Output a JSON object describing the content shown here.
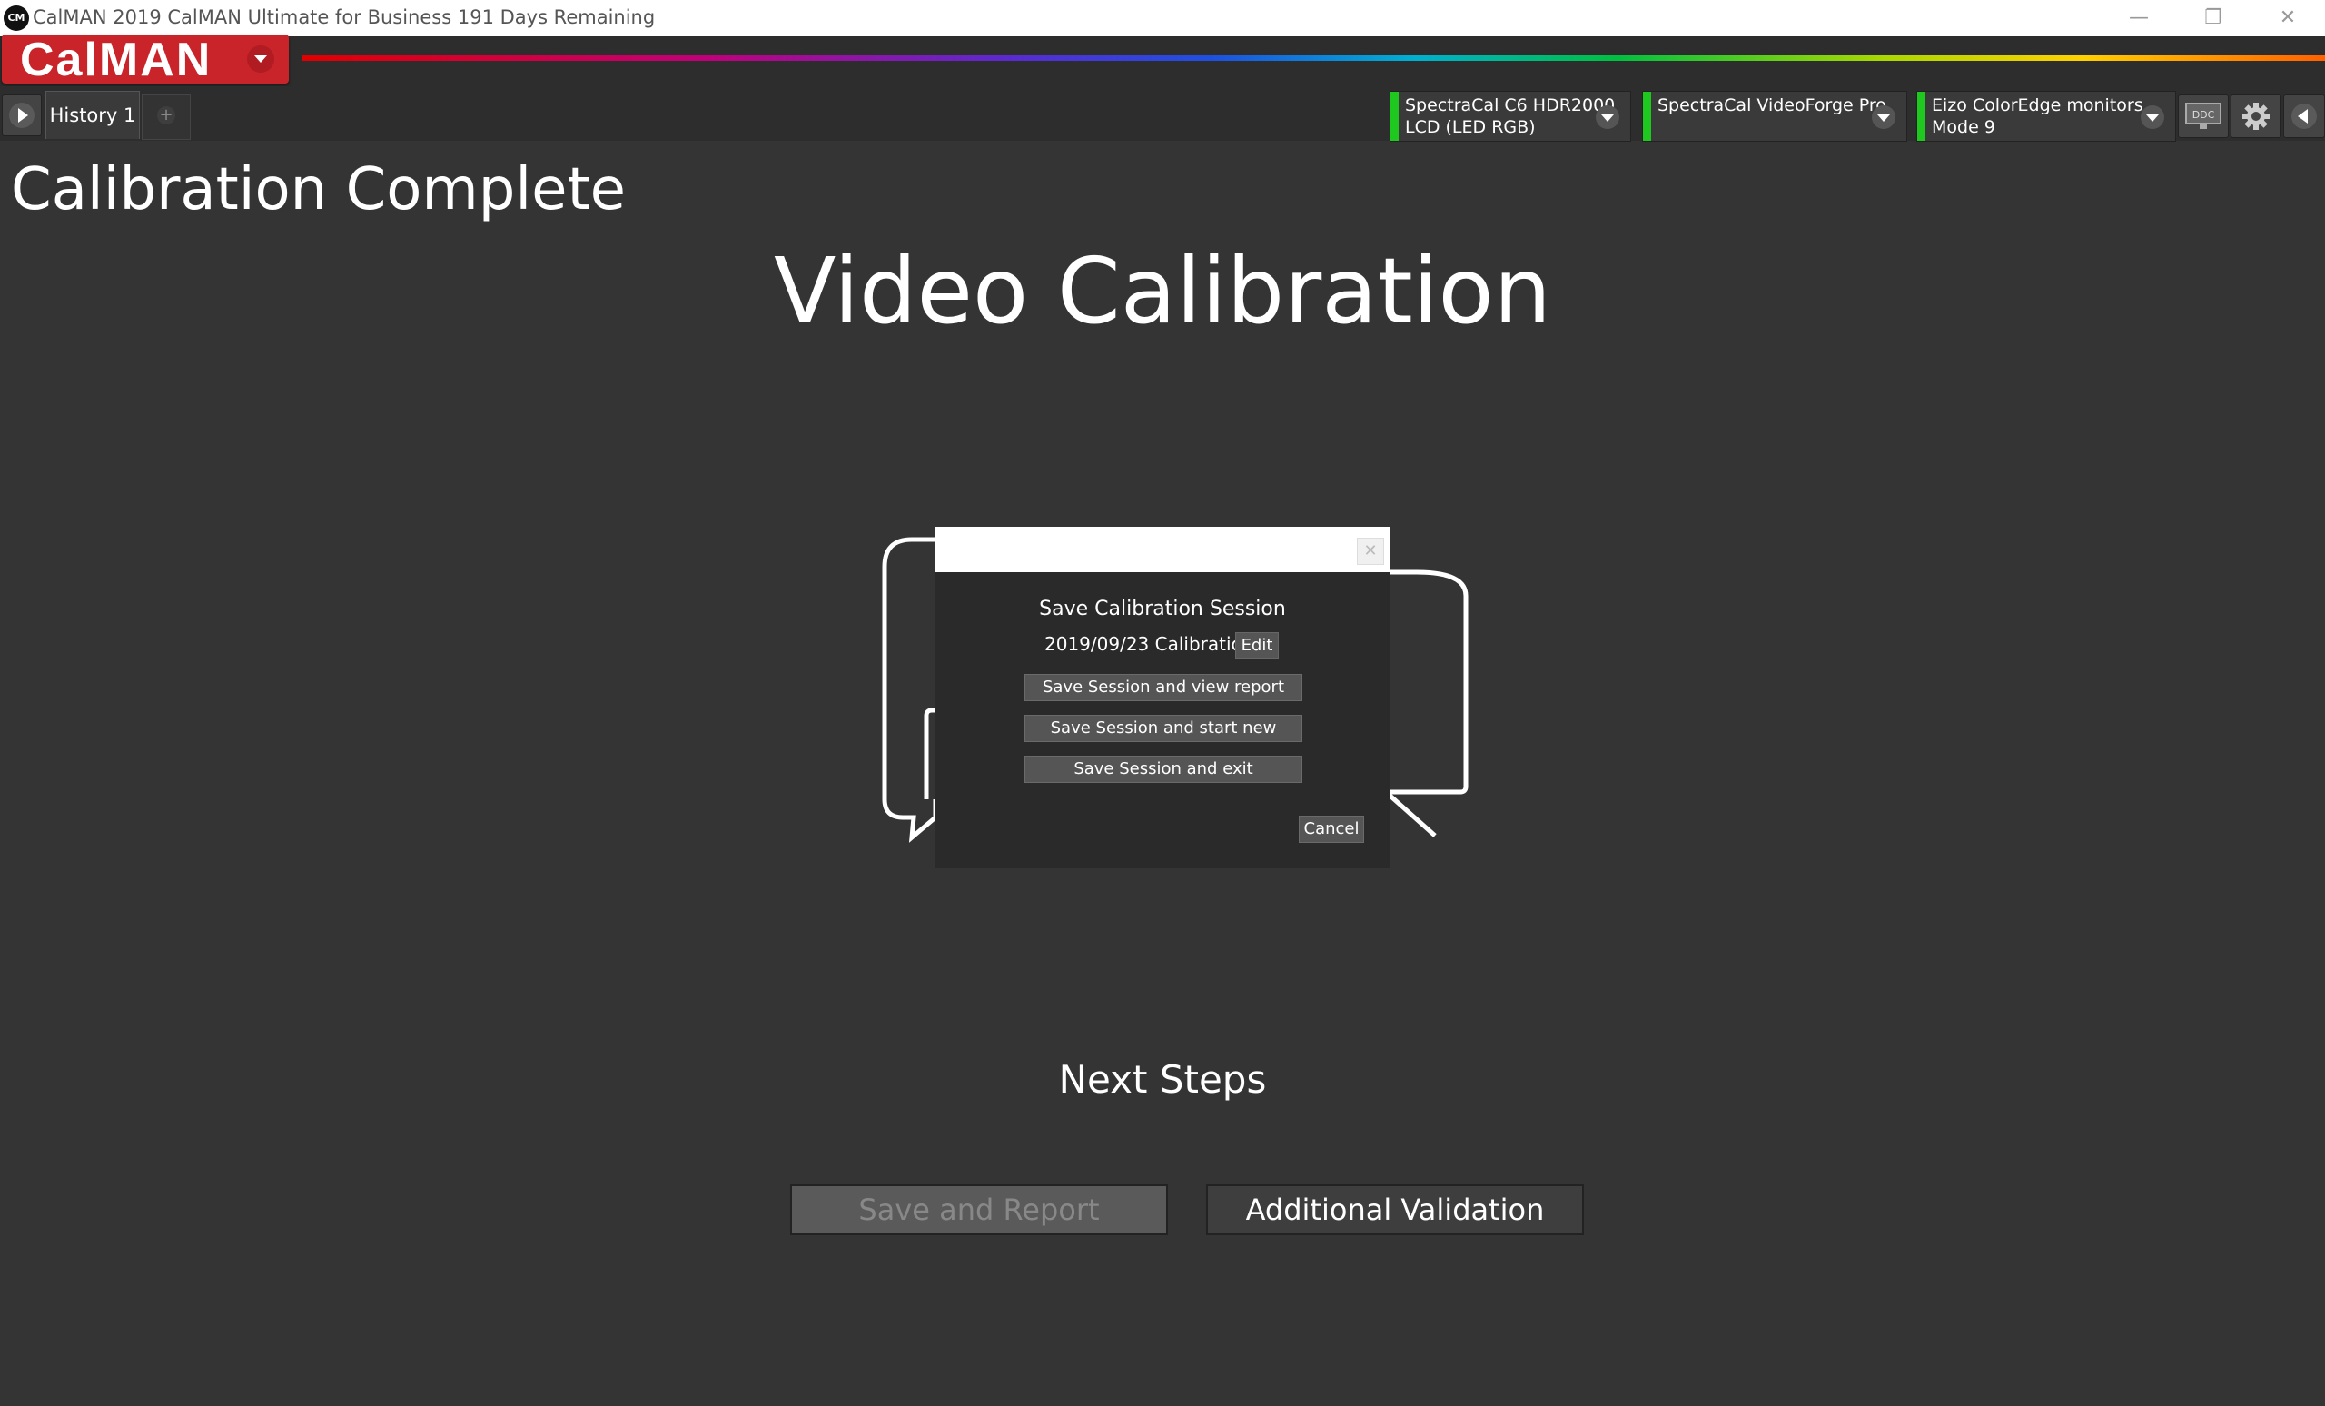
{
  "window": {
    "app_icon": "CM",
    "title": "CalMAN 2019 CalMAN Ultimate for Business 191 Days Remaining",
    "controls": {
      "minimize": "—",
      "restore": "❐",
      "close": "✕"
    }
  },
  "brand": {
    "logo_text": "CalMAN"
  },
  "tabs": [
    {
      "label": "History 1"
    }
  ],
  "tab_add_label": "+",
  "devices": [
    {
      "line1": "SpectraCal C6 HDR2000",
      "line2": "LCD (LED RGB)",
      "status_color": "#1ec81e"
    },
    {
      "line1": "SpectraCal VideoForge Pro",
      "line2": "",
      "status_color": "#1ec81e"
    },
    {
      "line1": "Eizo ColorEdge monitors",
      "line2": "Mode 9",
      "status_color": "#1ec81e"
    }
  ],
  "toolbar_right": {
    "ddc_label": "DDC",
    "settings_icon": "gear-icon",
    "collapse_icon": "chevron-left-icon"
  },
  "main": {
    "page_title": "Calibration Complete",
    "heading": "Video Calibration",
    "next_steps": "Next Steps",
    "buttons": {
      "save_and_report": "Save and Report",
      "additional_validation": "Additional Validation"
    }
  },
  "dialog": {
    "close_label": "✕",
    "heading": "Save Calibration Session",
    "session_name": "2019/09/23 Calibration",
    "edit_label": "Edit",
    "options": [
      {
        "label": "Save Session and view report"
      },
      {
        "label": "Save Session and start new"
      },
      {
        "label": "Save Session and exit"
      }
    ],
    "cancel_label": "Cancel"
  },
  "colors": {
    "background": "#343434",
    "brand_red": "#c9242a",
    "status_green": "#1ec81e"
  }
}
